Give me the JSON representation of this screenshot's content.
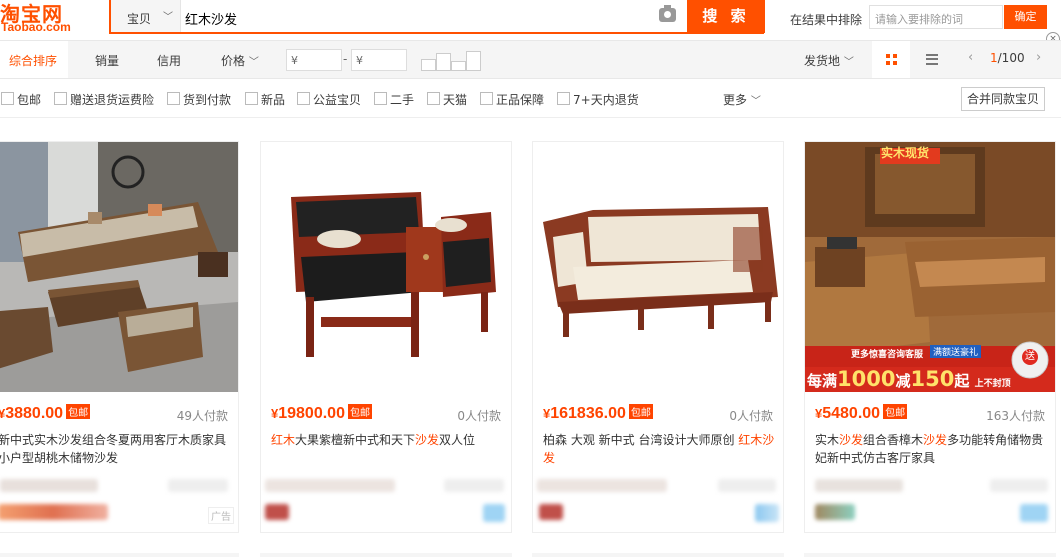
{
  "header": {
    "logo_cn": "淘宝网",
    "logo_en": "Taobao.com",
    "search_scope": "宝贝",
    "search_query": "红木沙发",
    "search_button": "搜 索",
    "exclude_label": "在结果中排除",
    "exclude_placeholder": "请输入要排除的词",
    "exclude_button": "确定",
    "close_glyph": "×"
  },
  "sortbar": {
    "sort_default": "综合排序",
    "sort_sales": "销量",
    "sort_credit": "信用",
    "sort_price": "价格",
    "price_min_placeholder": "¥",
    "price_max_placeholder": "¥",
    "price_dash": "-",
    "ship_from": "发货地",
    "page_current": "1",
    "page_total": "/100",
    "prev_glyph": "‹",
    "next_glyph": "›",
    "chevron": "﹀"
  },
  "filters": {
    "items": [
      "包邮",
      "赠送退货运费险",
      "货到付款",
      "新品",
      "公益宝贝",
      "二手",
      "天猫",
      "正品保障",
      "7+天内退货"
    ],
    "more": "更多",
    "merge": "合并同款宝贝"
  },
  "products": [
    {
      "price_currency": "¥",
      "price": "3880.00",
      "badge": "包邮",
      "paid": "49人付款",
      "title_parts": [
        {
          "text": "新中式实木沙发组合冬夏两用客厅木质家具小户型胡桃木储物沙发",
          "hl": false
        }
      ],
      "ad": "广告"
    },
    {
      "price_currency": "¥",
      "price": "19800.00",
      "badge": "包邮",
      "paid": "0人付款",
      "title_parts": [
        {
          "text": "红木",
          "hl": true
        },
        {
          "text": "大果紫檀新中式和天下",
          "hl": false
        },
        {
          "text": "沙发",
          "hl": true
        },
        {
          "text": "双人位",
          "hl": false
        }
      ]
    },
    {
      "price_currency": "¥",
      "price": "161836.00",
      "badge": "包邮",
      "paid": "0人付款",
      "title_parts": [
        {
          "text": "柏森 大观 新中式 台湾设计大师原创 ",
          "hl": false
        },
        {
          "text": "红木沙发",
          "hl": true
        }
      ]
    },
    {
      "price_currency": "¥",
      "price": "5480.00",
      "badge": "包邮",
      "paid": "163人付款",
      "title_parts": [
        {
          "text": "实木",
          "hl": false
        },
        {
          "text": "沙发",
          "hl": true
        },
        {
          "text": "组合香樟木",
          "hl": false
        },
        {
          "text": "沙发",
          "hl": true
        },
        {
          "text": "多功能转角储物贵妃新中式仿古客厅家具",
          "hl": false
        }
      ],
      "promo_tag": "实木现货",
      "promo_bar": "更多惊喜咨询客服",
      "promo_coupon": "满额送豪礼",
      "promo_text_a": "每满",
      "promo_num_a": "1000",
      "promo_text_b": "减",
      "promo_num_b": "150",
      "promo_text_c": "起",
      "promo_text_d": "上不封顶",
      "promo_gift": "送"
    }
  ],
  "colors": {
    "brand": "#ff5000",
    "price": "#ff4400"
  },
  "icons": [
    "camera-icon",
    "grid-view-icon",
    "list-view-icon",
    "close-icon",
    "chevron-down-icon"
  ]
}
